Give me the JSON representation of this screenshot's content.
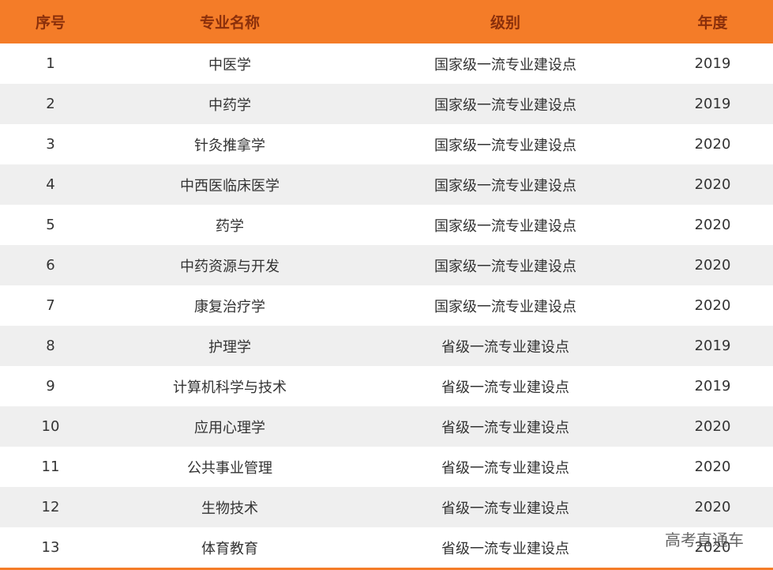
{
  "headers": {
    "index": "序号",
    "major": "专业名称",
    "level": "级别",
    "year": "年度"
  },
  "rows": [
    {
      "index": "1",
      "major": "中医学",
      "level": "国家级一流专业建设点",
      "year": "2019"
    },
    {
      "index": "2",
      "major": "中药学",
      "level": "国家级一流专业建设点",
      "year": "2019"
    },
    {
      "index": "3",
      "major": "针灸推拿学",
      "level": "国家级一流专业建设点",
      "year": "2020"
    },
    {
      "index": "4",
      "major": "中西医临床医学",
      "level": "国家级一流专业建设点",
      "year": "2020"
    },
    {
      "index": "5",
      "major": "药学",
      "level": "国家级一流专业建设点",
      "year": "2020"
    },
    {
      "index": "6",
      "major": "中药资源与开发",
      "level": "国家级一流专业建设点",
      "year": "2020"
    },
    {
      "index": "7",
      "major": "康复治疗学",
      "level": "国家级一流专业建设点",
      "year": "2020"
    },
    {
      "index": "8",
      "major": "护理学",
      "level": "省级一流专业建设点",
      "year": "2019"
    },
    {
      "index": "9",
      "major": "计算机科学与技术",
      "level": "省级一流专业建设点",
      "year": "2019"
    },
    {
      "index": "10",
      "major": "应用心理学",
      "level": "省级一流专业建设点",
      "year": "2020"
    },
    {
      "index": "11",
      "major": "公共事业管理",
      "level": "省级一流专业建设点",
      "year": "2020"
    },
    {
      "index": "12",
      "major": "生物技术",
      "level": "省级一流专业建设点",
      "year": "2020"
    },
    {
      "index": "13",
      "major": "体育教育",
      "level": "省级一流专业建设点",
      "year": "2020"
    }
  ],
  "watermark": "高考直通车",
  "colors": {
    "header_bg": "#f47c28",
    "header_text": "#8a2f0b",
    "row_alt": "#efefef"
  }
}
